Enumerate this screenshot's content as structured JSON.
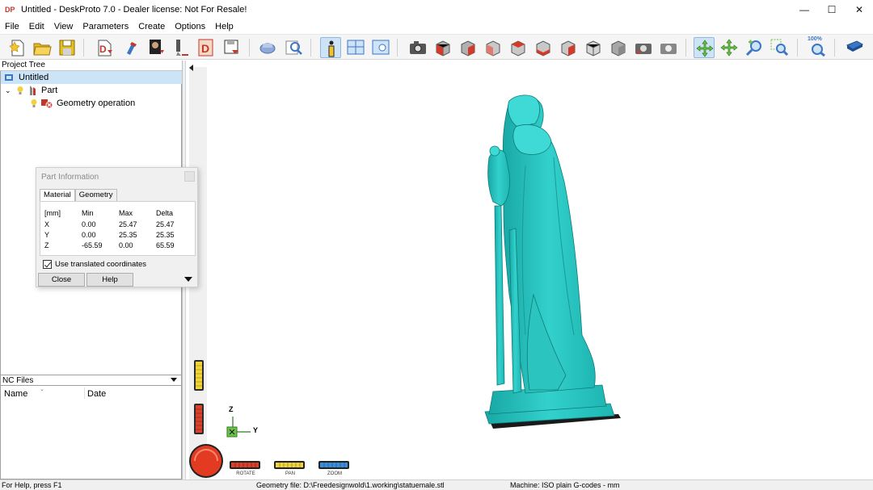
{
  "window": {
    "title": "Untitled - DeskProto 7.0 - Dealer license: Not For Resale!",
    "minimize": "—",
    "maximize": "☐",
    "close": "✕"
  },
  "menu": [
    "File",
    "Edit",
    "View",
    "Parameters",
    "Create",
    "Options",
    "Help"
  ],
  "toolbar": {
    "zoom_percent": "100%",
    "active_tool": "part-information"
  },
  "project_tree": {
    "header": "Project Tree",
    "project": "Untitled",
    "part": "Part",
    "operation": "Geometry operation"
  },
  "nc_files": {
    "header": "NC Files",
    "columns": [
      "Name",
      "Date"
    ]
  },
  "part_info": {
    "title": "Part Information",
    "tabs": [
      "Material",
      "Geometry"
    ],
    "headers": [
      "[mm]",
      "Min",
      "Max",
      "Delta"
    ],
    "rows": [
      {
        "axis": "X",
        "min": "0.00",
        "max": "25.47",
        "delta": "25.47"
      },
      {
        "axis": "Y",
        "min": "0.00",
        "max": "25.35",
        "delta": "25.35"
      },
      {
        "axis": "Z",
        "min": "-65.59",
        "max": "0.00",
        "delta": "65.59"
      }
    ],
    "checkbox_label": "Use translated coordinates",
    "checkbox_checked": true,
    "close_label": "Close",
    "help_label": "Help"
  },
  "viewport": {
    "axis_z": "Z",
    "axis_y": "Y",
    "controls": {
      "rotate": "ROTATE",
      "pan": "PAN",
      "zoom": "ZOOM"
    },
    "model_color": "#33d1cc"
  },
  "status": {
    "help": "For Help, press F1",
    "geometry_file": "Geometry file: D:\\Freedesignwold\\1.working\\statuemale.stl",
    "machine": "Machine: ISO plain G-codes - mm"
  }
}
